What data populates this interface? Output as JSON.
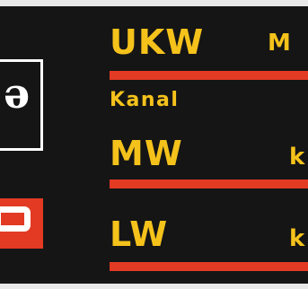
{
  "bands": [
    {
      "label": "UKW",
      "unit": "M"
    },
    {
      "label": "MW",
      "unit": "k"
    },
    {
      "label": "LW",
      "unit": "k"
    }
  ],
  "channel_label": "Kanal",
  "colors": {
    "text": "#f4c21b",
    "bar": "#e33a24",
    "background": "#151515"
  },
  "icons": {
    "logo": "brand-logo-icon",
    "tab": "red-tab-icon"
  }
}
